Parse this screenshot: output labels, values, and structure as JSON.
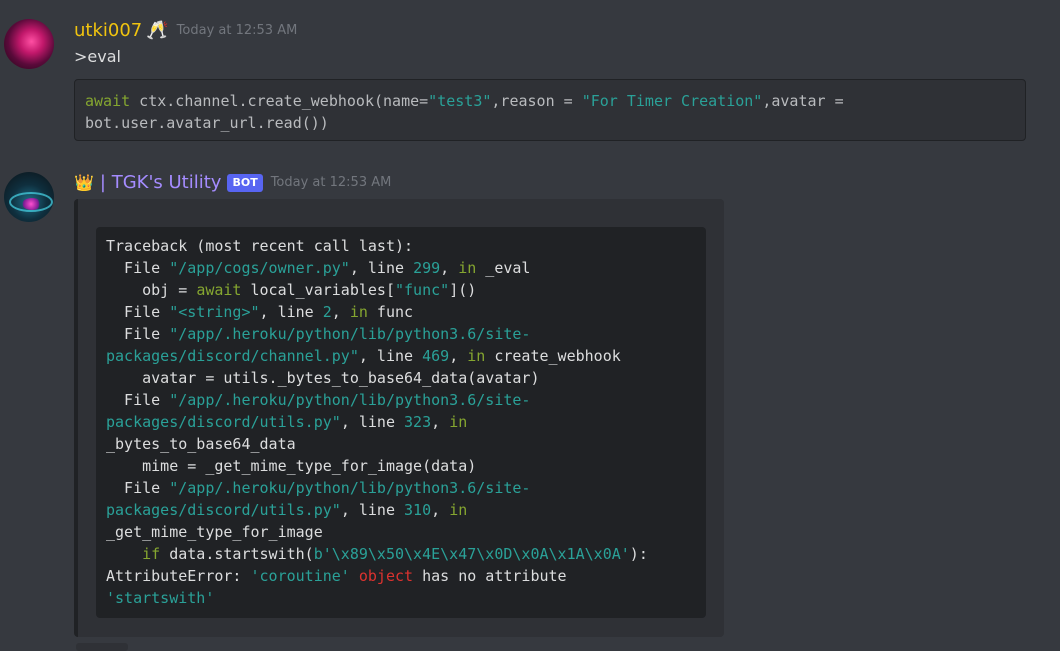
{
  "message1": {
    "author": "utki007",
    "author_emoji": "🥂",
    "timestamp": "Today at 12:53 AM",
    "text": ">eval",
    "code": {
      "line1": {
        "kw": "await",
        "a": " ctx.channel.create_webhook(name=",
        "s1": "\"test3\"",
        "b": ",reason = ",
        "s2": "\"For Timer Creation\"",
        "c": ",avatar ="
      },
      "line2": "bot.user.avatar_url.read())"
    }
  },
  "message2": {
    "crown_emoji": "👑",
    "author": "| TGK's Utility",
    "badge": "BOT",
    "timestamp": "Today at 12:53 AM",
    "traceback": {
      "l1": "Traceback (most recent call last):",
      "l2": {
        "pre": "  File ",
        "path": "\"/app/cogs/owner.py\"",
        "mid": ", line ",
        "num": "299",
        "sep": ", ",
        "kw": "in",
        "post": " _eval"
      },
      "l3": {
        "pre": "    obj = ",
        "kw": "await",
        "mid": " local_variables[",
        "str": "\"func\"",
        "post": "]()"
      },
      "l4": {
        "pre": "  File ",
        "path": "\"<string>\"",
        "mid": ", line ",
        "num": "2",
        "sep": ", ",
        "kw": "in",
        "post": " func"
      },
      "l5": {
        "pre": "  File ",
        "path": "\"/app/.heroku/python/lib/python3.6/site-"
      },
      "l6": {
        "path": "packages/discord/channel.py\"",
        "mid": ", line ",
        "num": "469",
        "sep": ", ",
        "kw": "in",
        "post": " create_webhook"
      },
      "l7": "    avatar = utils._bytes_to_base64_data(avatar)",
      "l8": {
        "pre": "  File ",
        "path": "\"/app/.heroku/python/lib/python3.6/site-"
      },
      "l9": {
        "path": "packages/discord/utils.py\"",
        "mid": ", line ",
        "num": "323",
        "sep": ", ",
        "kw": "in"
      },
      "l10": "_bytes_to_base64_data",
      "l11": "    mime = _get_mime_type_for_image(data)",
      "l12": {
        "pre": "  File ",
        "path": "\"/app/.heroku/python/lib/python3.6/site-"
      },
      "l13": {
        "path": "packages/discord/utils.py\"",
        "mid": ", line ",
        "num": "310",
        "sep": ", ",
        "kw": "in"
      },
      "l14": "_get_mime_type_for_image",
      "l15": {
        "pre": "    ",
        "kw": "if",
        "mid": " data.startswith(",
        "str": "b'\\x89\\x50\\x4E\\x47\\x0D\\x0A\\x1A\\x0A'",
        "post": "):"
      },
      "l16": {
        "pre": "AttributeError: ",
        "str": "'coroutine'",
        "sp": " ",
        "err": "object",
        "post": " has no attribute"
      },
      "l17": "'startswith'"
    }
  }
}
